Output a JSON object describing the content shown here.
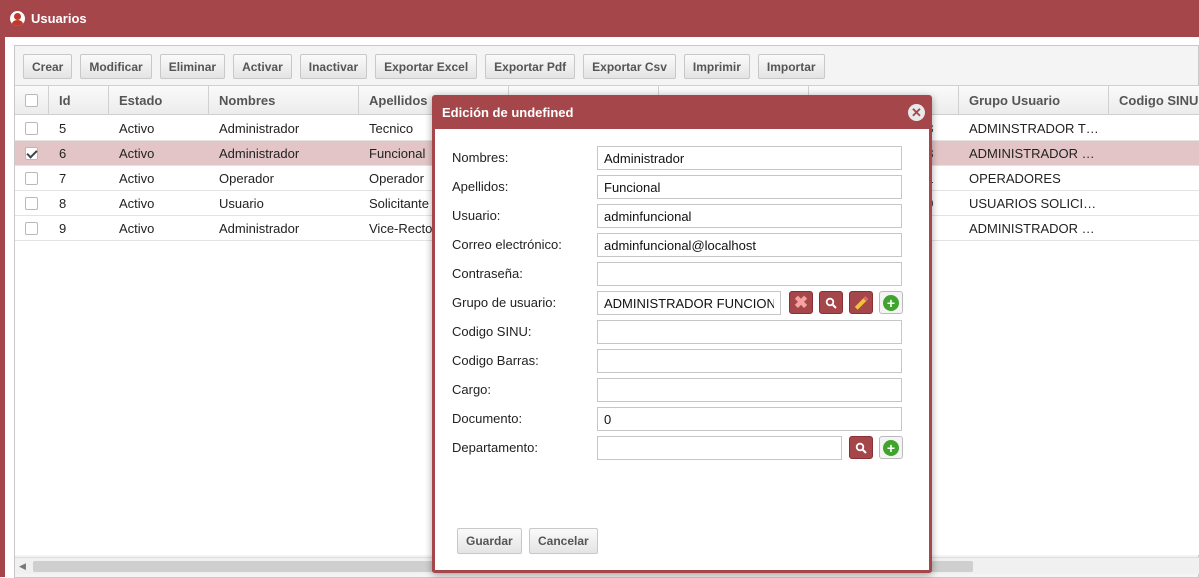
{
  "window": {
    "title": "Usuarios",
    "accent": "#a5464a"
  },
  "toolbar": {
    "crear": "Crear",
    "modificar": "Modificar",
    "eliminar": "Eliminar",
    "activar": "Activar",
    "inactivar": "Inactivar",
    "exportar_excel": "Exportar Excel",
    "exportar_pdf": "Exportar Pdf",
    "exportar_csv": "Exportar Csv",
    "imprimir": "Imprimir",
    "importar": "Importar"
  },
  "grid": {
    "headers": {
      "id": "Id",
      "estado": "Estado",
      "nombres": "Nombres",
      "apellidos": "Apellidos",
      "grupo": "Grupo Usuario",
      "codigo_sinu": "Codigo SINU"
    },
    "rows": [
      {
        "id": "5",
        "estado": "Activo",
        "nombres": "Administrador",
        "apellidos": "Tecnico",
        "partial": "58",
        "grupo": "ADMINSTRADOR T…",
        "checked": false
      },
      {
        "id": "6",
        "estado": "Activo",
        "nombres": "Administrador",
        "apellidos": "Funcional",
        "partial": "38",
        "grupo": "ADMINISTRADOR …",
        "checked": true
      },
      {
        "id": "7",
        "estado": "Activo",
        "nombres": "Operador",
        "apellidos": "Operador",
        "partial": "31",
        "grupo": "OPERADORES",
        "checked": false
      },
      {
        "id": "8",
        "estado": "Activo",
        "nombres": "Usuario",
        "apellidos": "Solicitante",
        "partial": "49",
        "grupo": "USUARIOS SOLICI…",
        "checked": false
      },
      {
        "id": "9",
        "estado": "Activo",
        "nombres": "Administrador",
        "apellidos": "Vice-Recto",
        "partial": "3",
        "grupo": "ADMINISTRADOR …",
        "checked": false
      }
    ]
  },
  "modal": {
    "title": "Edición de undefined",
    "fields": {
      "nombres": {
        "label": "Nombres:",
        "value": "Administrador"
      },
      "apellidos": {
        "label": "Apellidos:",
        "value": "Funcional"
      },
      "usuario": {
        "label": "Usuario:",
        "value": "adminfuncional"
      },
      "correo": {
        "label": "Correo electrónico:",
        "value": "adminfuncional@localhost"
      },
      "contrasena": {
        "label": "Contraseña:",
        "value": ""
      },
      "grupo": {
        "label": "Grupo de usuario:",
        "value": "ADMINISTRADOR FUNCIONAL"
      },
      "codigo_sinu": {
        "label": "Codigo SINU:",
        "value": ""
      },
      "codigo_barras": {
        "label": "Codigo Barras:",
        "value": ""
      },
      "cargo": {
        "label": "Cargo:",
        "value": ""
      },
      "documento": {
        "label": "Documento:",
        "value": "0"
      },
      "departamento": {
        "label": "Departamento:",
        "value": ""
      }
    },
    "guardar": "Guardar",
    "cancelar": "Cancelar"
  }
}
